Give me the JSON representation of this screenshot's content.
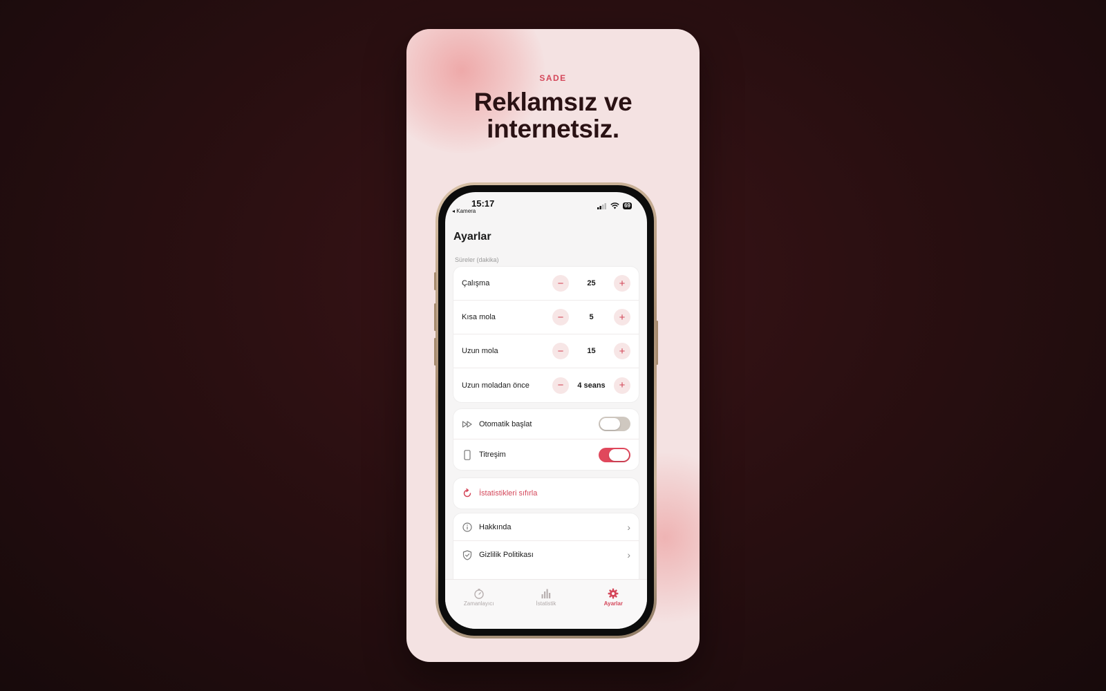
{
  "promo": {
    "eyebrow": "SADE",
    "headline_line1": "Reklamsız ve",
    "headline_line2": "internetsiz."
  },
  "status_bar": {
    "time": "15:17",
    "back_label": "◂ Kamera",
    "battery": "69"
  },
  "page": {
    "title": "Ayarlar",
    "section_label": "Süreler (dakika)"
  },
  "durations": [
    {
      "label": "Çalışma",
      "value": "25"
    },
    {
      "label": "Kısa mola",
      "value": "5"
    },
    {
      "label": "Uzun mola",
      "value": "15"
    },
    {
      "label": "Uzun moladan önce",
      "value": "4 seans"
    }
  ],
  "stepper": {
    "minus": "−",
    "plus": "+"
  },
  "toggles": [
    {
      "label": "Otomatik başlat",
      "on": false,
      "icon": "fast-forward-icon"
    },
    {
      "label": "Titreşim",
      "on": true,
      "icon": "phone-icon"
    }
  ],
  "reset": {
    "label": "İstatistikleri sıfırla",
    "icon": "refresh-icon"
  },
  "links": [
    {
      "label": "Hakkında",
      "icon": "info-icon"
    },
    {
      "label": "Gizlilik Politikası",
      "icon": "shield-check-icon"
    }
  ],
  "tabs": [
    {
      "label": "Zamanlayıcı",
      "icon": "timer-icon",
      "active": false
    },
    {
      "label": "İstatistik",
      "icon": "bar-chart-icon",
      "active": false
    },
    {
      "label": "Ayarlar",
      "icon": "gear-icon",
      "active": true
    }
  ],
  "colors": {
    "accent": "#d4475a",
    "toggle_off": "#cfc8c0",
    "toggle_on": "#e0485c",
    "card_bg": "#f4e2e2",
    "page_bg": "#2a0f11"
  }
}
